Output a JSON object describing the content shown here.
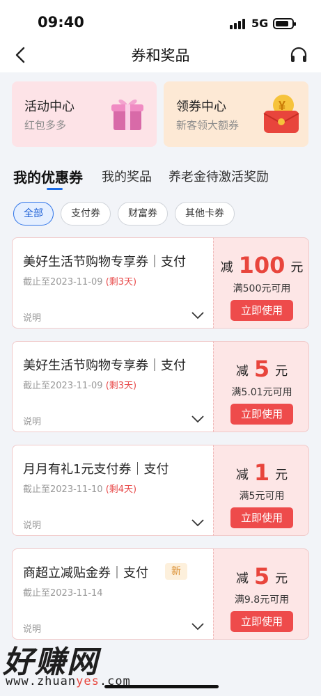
{
  "status_bar": {
    "time": "09:40",
    "network": "5G"
  },
  "nav": {
    "title": "券和奖品"
  },
  "promos": [
    {
      "title": "活动中心",
      "subtitle": "红包多多"
    },
    {
      "title": "领券中心",
      "subtitle": "新客领大额券"
    }
  ],
  "tabs": [
    "我的优惠券",
    "我的奖品",
    "养老金待激活奖励"
  ],
  "filters": [
    "全部",
    "支付券",
    "财富券",
    "其他卡券"
  ],
  "coupons": [
    {
      "title": "美好生活节购物专享券｜支付",
      "date": "截止至2023-11-09",
      "remaining": "(剩3天)",
      "note": "说明",
      "prefix": "减",
      "amount": "100",
      "unit": "元",
      "condition": "满500元可用",
      "button": "立即使用"
    },
    {
      "title": "美好生活节购物专享券｜支付",
      "date": "截止至2023-11-09",
      "remaining": "(剩3天)",
      "note": "说明",
      "prefix": "减",
      "amount": "5",
      "unit": "元",
      "condition": "满5.01元可用",
      "button": "立即使用"
    },
    {
      "title": "月月有礼1元支付券｜支付",
      "date": "截止至2023-11-10",
      "remaining": "(剩4天)",
      "note": "说明",
      "prefix": "减",
      "amount": "1",
      "unit": "元",
      "condition": "满5元可用",
      "button": "立即使用"
    },
    {
      "title": "商超立减贴金券｜支付",
      "badge": "新",
      "date": "截止至2023-11-14",
      "note": "说明",
      "prefix": "减",
      "amount": "5",
      "unit": "元",
      "condition": "满9.8元可用",
      "button": "立即使用"
    }
  ],
  "watermark": {
    "logo": "好赚网",
    "url_prefix": "www.zhuan",
    "url_highlight": "yes",
    "url_suffix": ".com"
  },
  "icons": {
    "back": "back-arrow-icon",
    "service": "headset-icon",
    "gift": "gift-box-icon",
    "red_envelope": "red-envelope-icon",
    "expand": "chevron-down-icon"
  },
  "colors": {
    "accent": "#1a6be7",
    "danger": "#ee4b4b",
    "amount": "#e8453c"
  }
}
